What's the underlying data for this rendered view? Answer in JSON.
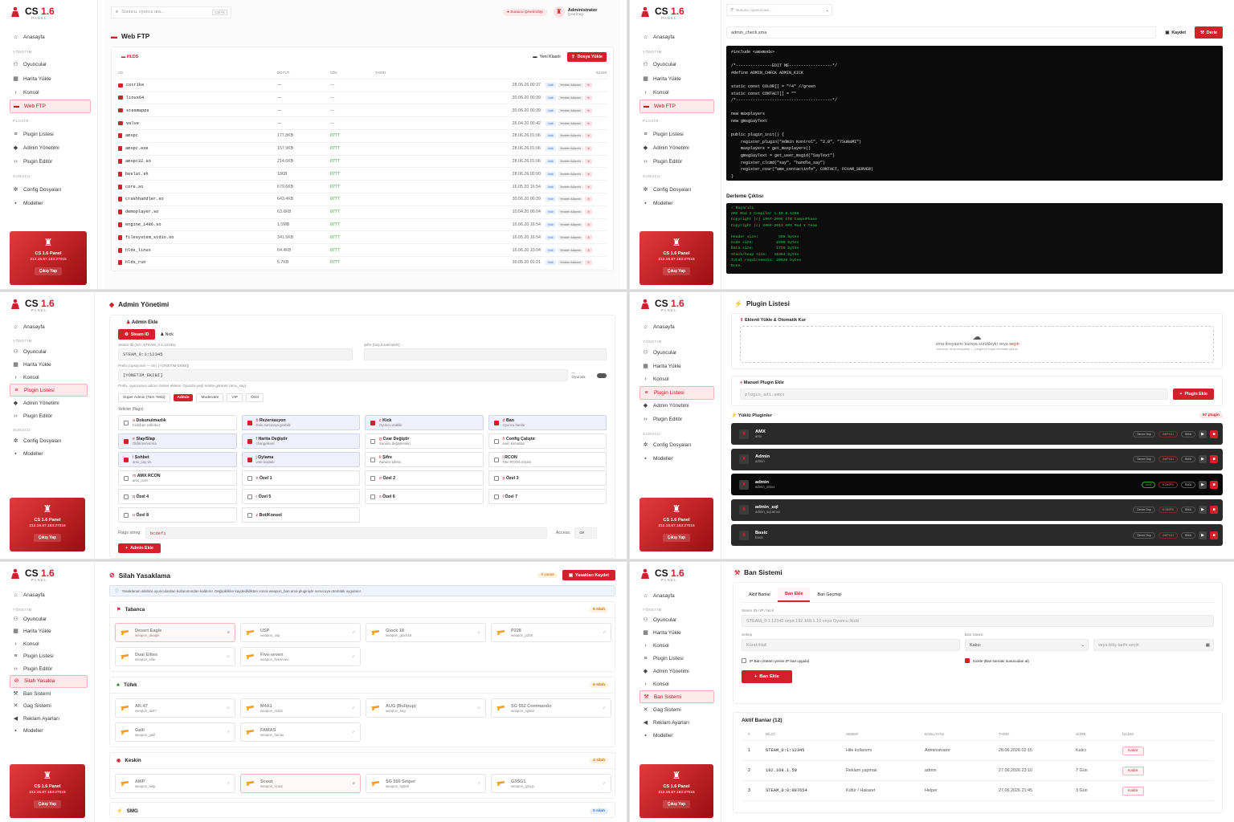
{
  "brand": {
    "name_a": "CS",
    "name_b": "1.6",
    "sub": "PANEL"
  },
  "nav": {
    "home": "Anasayfa",
    "sec_manage": "YÖNETİM",
    "players": "Oyuncular",
    "map": "Harita Yükle",
    "console": "Konsol",
    "ftp": "Web FTP",
    "sec_plugin": "PLUGIN",
    "plugin_list": "Plugin Listesi",
    "admin_manage": "Admin Yönetimi",
    "plugin_editor": "Plugin Editör",
    "sec_server": "SUNUCU",
    "config": "Config Dosyaları",
    "models": "Modeller",
    "weapon_ban": "Silah Yasakla",
    "ban_system": "Ban Sistemi",
    "gag_system": "Gag Sistemi",
    "ads": "Reklam Ayarları"
  },
  "sidecard": {
    "title": "CS 1.6 Panel",
    "ip": "212.16.67.183:27015",
    "logout": "Çıkış Yap"
  },
  "topbar": {
    "search_placeholder": "Sunucu, oyuncu ara...",
    "shortcut": "Ctrl+K",
    "status": "Sunucu Çevrimdışı",
    "user": "Administrator",
    "user_status": "Çevrimiçi"
  },
  "ftp": {
    "title": "Web FTP",
    "path": "HLDS",
    "new_folder": "Yeni Klasör",
    "upload": "Dosya Yükle",
    "headers": {
      "name": "AD",
      "size": "BOYUT",
      "perm": "İZİN",
      "date": "TARİH",
      "action": "İŞLEM"
    },
    "act_download": "İndir",
    "act_rename": "Yeniden Adlandır",
    "rows": [
      {
        "name": "cstrike",
        "size": "—",
        "perm": "—",
        "date": "28.06.26 00:37",
        "dir": true
      },
      {
        "name": "linux64",
        "size": "—",
        "perm": "—",
        "date": "30.06.20 00:39",
        "dir": true
      },
      {
        "name": "steamapps",
        "size": "—",
        "perm": "—",
        "date": "30.06.20 00:39",
        "dir": true
      },
      {
        "name": "valve",
        "size": "—",
        "perm": "—",
        "date": "26.04.20 00:42",
        "dir": true
      },
      {
        "name": "amxpc",
        "size": "177.8KB",
        "perm": "0777",
        "date": "28.06.26 01:06",
        "dir": false
      },
      {
        "name": "amxpc.exe",
        "size": "157.9KB",
        "perm": "0777",
        "date": "28.06.26 01:06",
        "dir": false
      },
      {
        "name": "amxpc32.so",
        "size": "214.6KB",
        "perm": "0777",
        "date": "28.06.26 01:06",
        "dir": false
      },
      {
        "name": "beslat.sh",
        "size": "186B",
        "perm": "0777",
        "date": "28.06.26 00:00",
        "dir": false
      },
      {
        "name": "core.so",
        "size": "679.6KB",
        "perm": "0777",
        "date": "16.05.20 16:54",
        "dir": false
      },
      {
        "name": "crashhandler.so",
        "size": "643.4KB",
        "perm": "0777",
        "date": "30.06.20 00:39",
        "dir": false
      },
      {
        "name": "demoplayer.so",
        "size": "63.6KB",
        "perm": "0777",
        "date": "10.04.20 00:04",
        "dir": false
      },
      {
        "name": "engine_i486.so",
        "size": "1.0MB",
        "perm": "0777",
        "date": "16.06.20 16:54",
        "dir": false
      },
      {
        "name": "filesystem_stdio.so",
        "size": "341.5KB",
        "perm": "0777",
        "date": "16.05.20 16:54",
        "dir": false
      },
      {
        "name": "hlds_linux",
        "size": "64.4KB",
        "perm": "0777",
        "date": "16.06.20 10:04",
        "dir": false
      },
      {
        "name": "hlds_run",
        "size": "5.7KB",
        "perm": "0777",
        "date": "30.05.20 01:21",
        "dir": false
      }
    ]
  },
  "editor": {
    "search_placeholder": "Sunucu, oyuncu ara...",
    "filename": "admin_check.sma",
    "save": "Kaydet",
    "compile": "Derle",
    "code": "#include <amxmodx>\n\n/*---------------EDIT ME------------------*/\n#define ADMIN_CHECK ADMIN_KICK\n\nstatic const COLOR[] = \"^4\" //green\nstatic const CONTACT[] = \"\"\n/*----------------------------------------*/\n\nnew maxplayers\nnew gmsgSayText\n\npublic plugin_init() {\n    register_plugin(\"Admin Kontrol\", \"2.0\", \"7SuNaMI\")\n    maxplayers = get_maxplayers()\n    gmsgSayText = get_user_msgid(\"SayText\")\n    register_clcmd(\"say\", \"handle_say\")\n    register_cvar(\"amx_contactinfo\", CONTACT, FCVAR_SERVER)\n}",
    "output_title": "Derleme Çıktısı",
    "output": "✓ Başarılı\nAMX Mod X Compiler 1.10.0.5299\nCopyright (c) 1997-2006 ITB CompuPhase\nCopyright (c) 2004-2013 AMX Mod X Team\n\nHeader size:         588 bytes\nCode size:          2200 bytes\nData size:          1728 bytes\nStack/heap size:   16384 bytes\nTotal requirements: 20920 bytes\nDone."
  },
  "admin": {
    "title": "Admin Yönetimi",
    "add_title": "Admin Ekle",
    "tab_steam": "Steam ID",
    "tab_nick": "Nick",
    "steam_label": "Steam ID (örn: STEAM_0:1:12345)",
    "steam_value": "STEAM_0:1:12345",
    "pass_label": "Şifre (boş bırakılabilir)",
    "prefix_label": "Prefix (opsiyonel — örn: [YONETIM EKIBI])",
    "prefix_value": "[YONETIM EKIBI]",
    "in_game": "— Oyunda:",
    "prefix_hint": "Prefix, oyuncunun adının önüne eklenir. Oyunda yeşil renkte görünür (amx_say).",
    "roles": [
      "Süper Admin (Tam Yetki)",
      "Admin",
      "Moderatör",
      "VIP",
      "Özel"
    ],
    "flags_label": "Yetkiler (flags)",
    "flags": [
      {
        "k": "a",
        "name": "Dokunulmazlık",
        "desc": "Kick/ban edilemez",
        "on": false
      },
      {
        "k": "b",
        "name": "Rezervasyon",
        "desc": "Dolu sunucuya girebilir",
        "on": true
      },
      {
        "k": "c",
        "name": "Kick",
        "desc": "Oyuncu atabilir",
        "on": true
      },
      {
        "k": "d",
        "name": "Ban",
        "desc": "Oyuncu banlar",
        "on": true
      },
      {
        "k": "e",
        "name": "Slay/Slap",
        "desc": "Öldürme/vurma",
        "on": true
      },
      {
        "k": "f",
        "name": "Harita Değiştir",
        "desc": "changelevel",
        "on": true
      },
      {
        "k": "g",
        "name": "Cvar Değiştir",
        "desc": "Sunucu değişkenleri",
        "on": false
      },
      {
        "k": "h",
        "name": "Config Çalıştır",
        "desc": "exec komutları",
        "on": false
      },
      {
        "k": "i",
        "name": "Sohbet",
        "desc": "amx_say vb.",
        "on": true
      },
      {
        "k": "j",
        "name": "Oylama",
        "desc": "vote başlatır",
        "on": true
      },
      {
        "k": "k",
        "name": "Şifre",
        "desc": "Sunucu şifresi",
        "on": false
      },
      {
        "k": "l",
        "name": "RCON",
        "desc": "Tam RCON erişimi",
        "on": false
      },
      {
        "k": "m",
        "name": "AMX RCON",
        "desc": "amx_rcon",
        "on": false
      },
      {
        "k": "n",
        "name": "Özel 1",
        "desc": "",
        "on": false
      },
      {
        "k": "o",
        "name": "Özel 2",
        "desc": "",
        "on": false
      },
      {
        "k": "p",
        "name": "Özel 3",
        "desc": "",
        "on": false
      },
      {
        "k": "q",
        "name": "Özel 4",
        "desc": "",
        "on": false
      },
      {
        "k": "r",
        "name": "Özel 5",
        "desc": "",
        "on": false
      },
      {
        "k": "s",
        "name": "Özel 6",
        "desc": "",
        "on": false
      },
      {
        "k": "t",
        "name": "Özel 7",
        "desc": "",
        "on": false
      },
      {
        "k": "u",
        "name": "Özel 8",
        "desc": "",
        "on": false
      },
      {
        "k": "z",
        "name": "Bot/Konsol",
        "desc": "",
        "on": false
      }
    ],
    "flags_string_label": "Flags string:",
    "flags_string": "bcdefi",
    "access_label": "Access:",
    "access_value": "ce",
    "submit": "Admin Ekle"
  },
  "plugins": {
    "title": "Plugin Listesi",
    "upload_title": "Eklenti Yükle & Otomatik Kur",
    "drop_text": ".sma dosyasını buraya sürükleyin veya",
    "drop_link": "seçin",
    "drop_hint": "Yalnızca .sma dosyaları — plugin.ini başa otomatik yazılır",
    "manual_title": "Manuel Plugin Ekle",
    "manual_placeholder": "plugin_adi.amxx",
    "manual_btn": "Plugin Ekle",
    "loaded_title": "Yüklü Pluginler",
    "count": "57 plugin",
    "list": [
      {
        "name": "AMX",
        "file": "amx",
        "state": "Devre Dışı",
        "tag": "AKPULI",
        "tag2": "SMA",
        "dark": false
      },
      {
        "name": "Admin",
        "file": "admin",
        "state": "Devre Dışı",
        "tag": "AKPULI",
        "tag2": "SMA",
        "dark": false
      },
      {
        "name": "admin",
        "file": "admin_amxx",
        "state": "Aktif",
        "tag": "KOMPS",
        "tag2": "SMA",
        "dark": true
      },
      {
        "name": "admin_sql",
        "file": "admin_sql.amxx",
        "state": "Devre Dışı",
        "tag": "KOMPS",
        "tag2": "SMA",
        "dark": false
      },
      {
        "name": "Basic",
        "file": "basic",
        "state": "Devre Dışı",
        "tag": "AKPULI",
        "tag2": "SMA",
        "dark": false
      }
    ]
  },
  "weapons": {
    "title": "Silah Yasaklama",
    "count": "9 yasak",
    "save": "Yasakları Kaydet",
    "info": "Yasaklanan silahlar oyunculardan kullanımından kaldırılır. Değişiklikler kaydedildikten sonra weapon_ban.ama pluginiyle sunucuya otomatik uygulanır.",
    "groups": [
      {
        "name": "Tabanca",
        "count": "6 silah",
        "items": [
          {
            "n": "Desert Eagle",
            "c": "weapon_deagle",
            "ban": true
          },
          {
            "n": "USP",
            "c": "weapon_usp",
            "ban": false
          },
          {
            "n": "Glock 18",
            "c": "weapon_glock18",
            "ban": false
          },
          {
            "n": "P228",
            "c": "weapon_p228",
            "ban": false
          },
          {
            "n": "Dual Elites",
            "c": "weapon_elite",
            "ban": false
          },
          {
            "n": "Five-seven",
            "c": "weapon_fiveseven",
            "ban": false
          }
        ]
      },
      {
        "name": "Tüfek",
        "count": "6 silah",
        "items": [
          {
            "n": "AK-47",
            "c": "weapon_ak47",
            "ban": false
          },
          {
            "n": "M4A1",
            "c": "weapon_m4a1",
            "ban": false
          },
          {
            "n": "AUG (Bullpup)",
            "c": "weapon_aug",
            "ban": false
          },
          {
            "n": "SG 552 Commando",
            "c": "weapon_sg552",
            "ban": false
          },
          {
            "n": "Galil",
            "c": "weapon_galil",
            "ban": false
          },
          {
            "n": "FAMAS",
            "c": "weapon_famas",
            "ban": false
          }
        ]
      },
      {
        "name": "Keskin",
        "count": "4 silah",
        "items": [
          {
            "n": "AWP",
            "c": "weapon_awp",
            "ban": false
          },
          {
            "n": "Scout",
            "c": "weapon_scout",
            "ban": true
          },
          {
            "n": "SG 550 Sniper",
            "c": "weapon_sg550",
            "ban": false
          },
          {
            "n": "G3SG1",
            "c": "weapon_g3sg1",
            "ban": false
          }
        ]
      }
    ],
    "smg": "SMG",
    "smg_count": "5 silah"
  },
  "ban": {
    "title": "Ban Sistemi",
    "tabs": [
      "Aktif Banlar",
      "Ban Ekle",
      "Ban Geçmişi"
    ],
    "id_label": "Steam ID / IP / Nick",
    "id_placeholder": "STEAM_0:1:12345 veya 192.168.1.10 veya Oyuncu Nicki",
    "reason_label": "Sebep",
    "reason_placeholder": "Kural ihlali",
    "duration_label": "Ban Süresi",
    "duration_value": "Kalıcı",
    "date_placeholder": "veya bitiş tarihi seçin",
    "ipban": "IP Ban (Steam yerine IP ban uygula)",
    "kick": "Kickle (Ban sonrası sunucudan at)",
    "submit": "Ban Ekle",
    "active_title": "Aktif Banlar (12)",
    "headers": [
      "#",
      "BİLGİ",
      "SEBEP",
      "BANLAYAN",
      "TARİH",
      "SÜRE",
      "İŞLEM"
    ],
    "remove": "Kaldır",
    "rows": [
      {
        "i": "1",
        "id": "STEAM_0:1:12345",
        "reason": "Hile kullanımı",
        "by": "Administrator",
        "date": "28.06.2026 02:15",
        "dur": "Kalıcı"
      },
      {
        "i": "2",
        "id": "192.168.1.50",
        "reason": "Reklam yapmak",
        "by": "admin",
        "date": "27.06.2026 23:10",
        "dur": "7 Gün"
      },
      {
        "i": "3",
        "id": "STEAM_0:0:987654",
        "reason": "Küfür / Hakaret",
        "by": "Helper",
        "date": "27.06.2026 21:45",
        "dur": "3 Gün"
      }
    ]
  },
  "colors": {
    "accent": "#d3212b",
    "dark": "#0b0b0b",
    "success": "#2aa42a"
  }
}
